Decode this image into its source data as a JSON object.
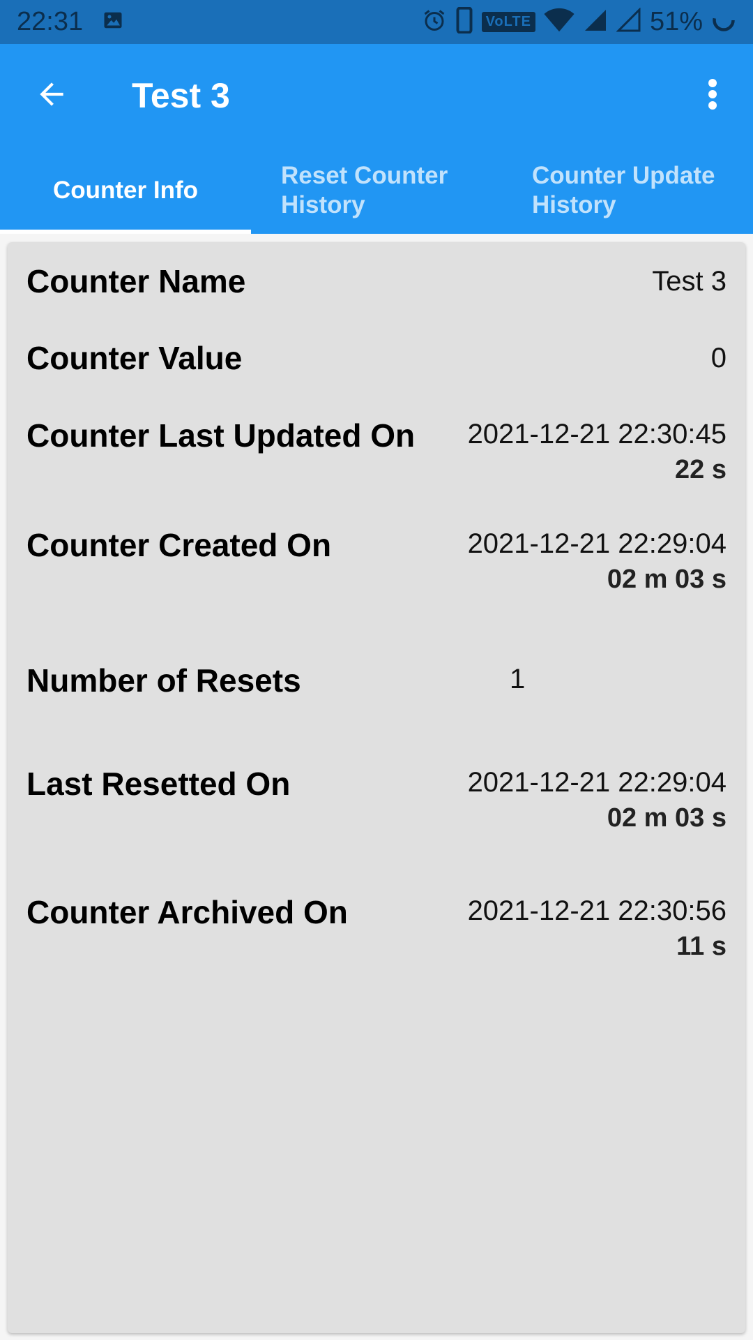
{
  "status_bar": {
    "time": "22:31",
    "battery_percent": "51%",
    "volte_label": "VoLTE",
    "icons": [
      "image-icon",
      "alarm-icon",
      "phone-icon",
      "volte-icon",
      "wifi-icon",
      "signal-icon",
      "signal-empty-icon",
      "battery-icon"
    ]
  },
  "app_bar": {
    "title": "Test 3",
    "back_icon": "arrow-back-icon",
    "more_icon": "more-vert-icon",
    "background": "#2196f3"
  },
  "tabs": [
    {
      "label": "Counter Info",
      "active": true
    },
    {
      "label": "Reset Counter History",
      "active": false
    },
    {
      "label": "Counter Update History",
      "active": false
    }
  ],
  "info": {
    "counter_name": {
      "label": "Counter Name",
      "value": "Test 3"
    },
    "counter_value": {
      "label": "Counter Value",
      "value": "0"
    },
    "last_updated": {
      "label": "Counter Last Updated On",
      "value": "2021-12-21 22:30:45",
      "ago": "22 s"
    },
    "created": {
      "label": "Counter Created On",
      "value": "2021-12-21 22:29:04",
      "ago": "02 m 03 s"
    },
    "resets": {
      "label": "Number of Resets",
      "value": "1"
    },
    "last_reset": {
      "label": "Last Resetted On",
      "value": "2021-12-21 22:29:04",
      "ago": "02 m 03 s"
    },
    "archived": {
      "label": "Counter Archived On",
      "value": "2021-12-21 22:30:56",
      "ago": "11 s"
    }
  }
}
